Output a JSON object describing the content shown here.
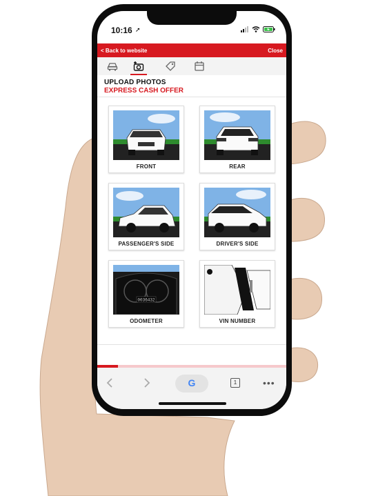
{
  "status": {
    "time": "10:16",
    "location_icon": "location-arrow-icon",
    "signal_icon": "signal-bars-icon",
    "wifi_icon": "wifi-icon",
    "battery_icon": "battery-charging-icon"
  },
  "header": {
    "back_label": "< Back to website",
    "close_label": "Close",
    "color": "#d71920"
  },
  "tabs": [
    {
      "icon": "car-icon",
      "active": false
    },
    {
      "icon": "camera-plus-icon",
      "active": true
    },
    {
      "icon": "price-tag-icon",
      "active": false
    },
    {
      "icon": "calendar-icon",
      "active": false
    }
  ],
  "page": {
    "title": "UPLOAD PHOTOS",
    "subtitle": "EXPRESS CASH OFFER"
  },
  "photos": [
    {
      "label": "FRONT"
    },
    {
      "label": "REAR"
    },
    {
      "label": "PASSENGER'S SIDE"
    },
    {
      "label": "DRIVER'S SIDE"
    },
    {
      "label": "ODOMETER",
      "odometer_reading": "0036432"
    },
    {
      "label": "VIN NUMBER"
    }
  ],
  "progress": {
    "fraction": 0.11
  },
  "browser": {
    "back_icon": "chevron-left-icon",
    "forward_icon": "chevron-right-icon",
    "search_logo": "G",
    "tab_count": "1",
    "more_icon": "more-dots-icon"
  }
}
